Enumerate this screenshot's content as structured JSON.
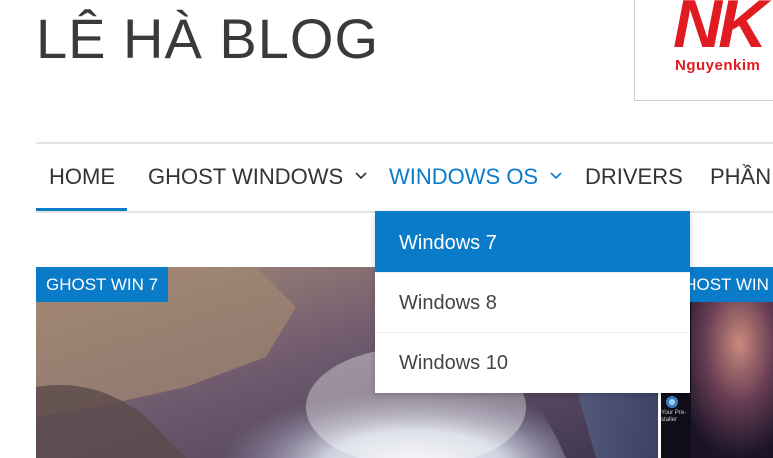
{
  "site": {
    "title": "LÊ HÀ BLOG"
  },
  "ad": {
    "logo_letters": "NK",
    "logo_text": "Nguyenkim"
  },
  "nav": {
    "items": [
      {
        "label": "HOME",
        "has_dropdown": false,
        "active": true
      },
      {
        "label": "GHOST WINDOWS",
        "has_dropdown": true
      },
      {
        "label": "WINDOWS OS",
        "has_dropdown": true,
        "current": true
      },
      {
        "label": "DRIVERS",
        "has_dropdown": false
      },
      {
        "label": "PHẦN",
        "has_dropdown": false
      }
    ]
  },
  "dropdown": {
    "items": [
      {
        "label": "Windows 7",
        "highlighted": true
      },
      {
        "label": "Windows 8"
      },
      {
        "label": "Windows 10"
      }
    ]
  },
  "cards": [
    {
      "tag": "GHOST WIN 7"
    },
    {
      "tag": "GHOST WIN"
    }
  ],
  "desktop_icon_label": "Your Pre-staller",
  "colors": {
    "accent": "#0a7bc8",
    "brand_red": "#e11b22",
    "text": "#333333"
  }
}
